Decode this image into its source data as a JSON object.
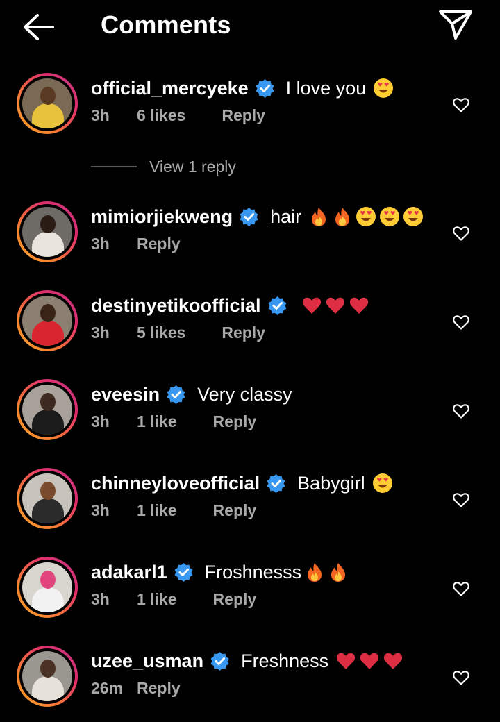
{
  "header": {
    "title": "Comments",
    "back_icon": "arrow-left-icon",
    "share_icon": "send-icon"
  },
  "colors": {
    "background": "#000000",
    "text": "#ffffff",
    "secondary_text": "#a8a8a8",
    "verified_badge": "#3897f0",
    "story_ring_start": "#f9a825",
    "story_ring_end": "#c13584"
  },
  "comments": [
    {
      "username": "official_mercyeke",
      "verified": true,
      "text": "I love you",
      "emojis": [
        "heart-eyes-emoji"
      ],
      "time": "3h",
      "likes": "6 likes",
      "reply_label": "Reply",
      "view_replies": "View 1 reply"
    },
    {
      "username": "mimiorjiekweng",
      "verified": true,
      "text": "hair",
      "emojis": [
        "fire-emoji",
        "fire-emoji",
        "heart-eyes-emoji",
        "heart-eyes-emoji",
        "heart-eyes-emoji"
      ],
      "time": "3h",
      "likes": "",
      "reply_label": "Reply"
    },
    {
      "username": "destinyetikoofficial",
      "verified": true,
      "text": "",
      "emojis": [
        "red-heart-emoji",
        "red-heart-emoji",
        "red-heart-emoji"
      ],
      "time": "3h",
      "likes": "5 likes",
      "reply_label": "Reply"
    },
    {
      "username": "eveesin",
      "verified": true,
      "text": "Very classy",
      "emojis": [],
      "time": "3h",
      "likes": "1 like",
      "reply_label": "Reply"
    },
    {
      "username": "chinneyloveofficial",
      "verified": true,
      "text": "Babygirl",
      "emojis": [
        "heart-eyes-emoji"
      ],
      "time": "3h",
      "likes": "1 like",
      "reply_label": "Reply"
    },
    {
      "username": "adakarl1",
      "verified": true,
      "text": "Froshnesss",
      "emojis": [
        "fire-emoji",
        "fire-emoji"
      ],
      "time": "3h",
      "likes": "1 like",
      "reply_label": "Reply"
    },
    {
      "username": "uzee_usman",
      "verified": true,
      "text": "Freshness",
      "emojis": [
        "red-heart-emoji",
        "red-heart-emoji",
        "red-heart-emoji"
      ],
      "time": "26m",
      "likes": "",
      "reply_label": "Reply"
    }
  ]
}
